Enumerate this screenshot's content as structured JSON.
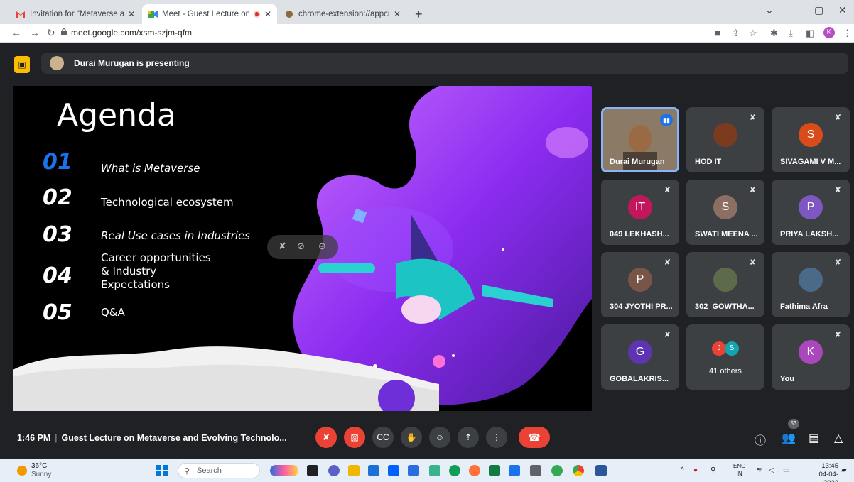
{
  "browser": {
    "tabs": [
      {
        "title": "Invitation for \"Metaverse and Evo",
        "favicon": "gmail-icon"
      },
      {
        "title": "Meet - Guest Lecture on Me",
        "favicon": "meet-icon"
      },
      {
        "title": "chrome-extension://appcnhiefcic",
        "favicon": "extension-icon"
      }
    ],
    "url": "meet.google.com/xsm-szjm-qfm",
    "profile_initial": "K"
  },
  "meet": {
    "presenter_text": "Durai Murugan is presenting",
    "slide": {
      "title": "Agenda",
      "items": [
        {
          "num": "01",
          "text": "What is Metaverse"
        },
        {
          "num": "02",
          "text": "Technological ecosystem"
        },
        {
          "num": "03",
          "text": "Real Use cases in Industries"
        },
        {
          "num": "04",
          "text": "Career opportunities\n& Industry\nExpectations"
        },
        {
          "num": "05",
          "text": "Q&A"
        }
      ]
    },
    "participants": [
      {
        "name": "Durai Murugan",
        "initial": "",
        "color": "#6b5a48"
      },
      {
        "name": "HOD IT",
        "initial": "",
        "color": "#7a3b1f"
      },
      {
        "name": "SIVAGAMI V M...",
        "initial": "S",
        "color": "#d94c1a"
      },
      {
        "name": "049 LEKHASH...",
        "initial": "IT",
        "color": "#c2185b"
      },
      {
        "name": "SWATI MEENA ...",
        "initial": "S",
        "color": "#8d6e63"
      },
      {
        "name": "PRIYA LAKSH...",
        "initial": "P",
        "color": "#7e57c2"
      },
      {
        "name": "304 JYOTHI PR...",
        "initial": "P",
        "color": "#795548"
      },
      {
        "name": "302_GOWTHA...",
        "initial": "",
        "color": "#5d6b4b"
      },
      {
        "name": "Fathima Afra",
        "initial": "",
        "color": "#4b6a8a"
      },
      {
        "name": "GOBALAKRIS...",
        "initial": "G",
        "color": "#5e35b1"
      },
      {
        "name": "41 others",
        "initial": "",
        "color": "#3c4043"
      },
      {
        "name": "You",
        "initial": "K",
        "color": "#ab47bc"
      }
    ],
    "others_avatars": [
      "J",
      "S"
    ],
    "time": "1:46 PM",
    "meeting_title": "Guest Lecture on Metaverse and Evolving Technolo...",
    "people_count": "53"
  },
  "taskbar": {
    "temp": "36°C",
    "weather": "Sunny",
    "search_label": "Search",
    "lang_top": "ENG",
    "lang_bottom": "IN",
    "time": "13:45",
    "date": "04-04-2023"
  }
}
